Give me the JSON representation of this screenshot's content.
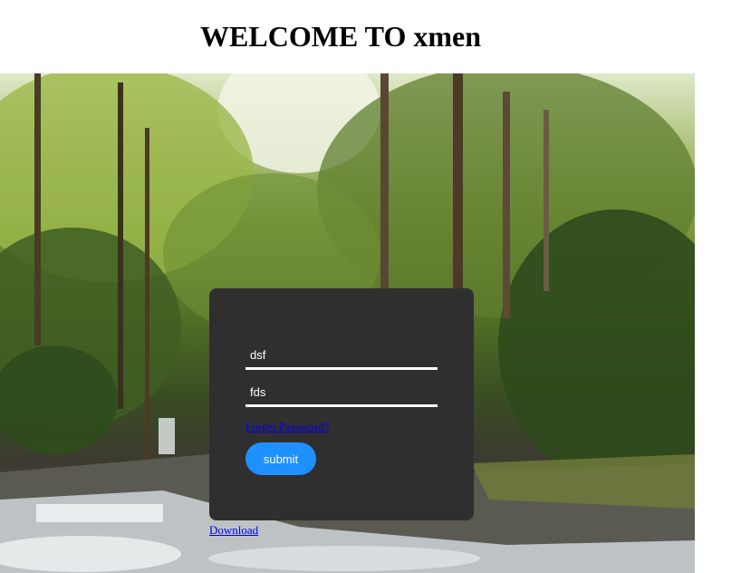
{
  "page": {
    "heading": "WELCOME TO xmen"
  },
  "login": {
    "username_value": "dsf",
    "password_value": "fds",
    "forgot_label": "Forget Password?",
    "submit_label": "submit"
  },
  "footer": {
    "download_label": "Download"
  },
  "colors": {
    "card_background": "#2f2f2f",
    "submit_background": "#1e90ff",
    "link": "#0000ee"
  },
  "background_image": "forest-waterfall-photo"
}
